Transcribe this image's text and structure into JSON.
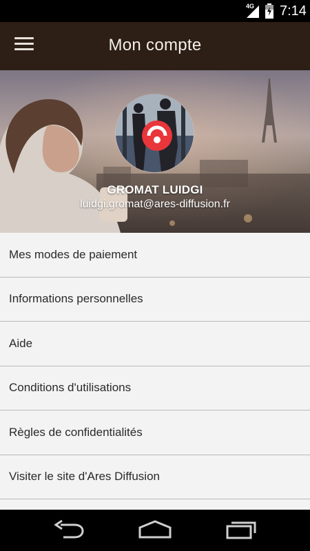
{
  "status_bar": {
    "network": "4G",
    "time": "7:14"
  },
  "app_bar": {
    "title": "Mon compte",
    "menu_icon": "hamburger-menu-icon"
  },
  "profile": {
    "name": "GROMAT LUIDGI",
    "email": "luidgi.gromat@ares-diffusion.fr"
  },
  "menu": {
    "items": [
      {
        "label": "Mes modes de paiement"
      },
      {
        "label": "Informations personnelles"
      },
      {
        "label": "Aide"
      },
      {
        "label": "Conditions d'utilisations"
      },
      {
        "label": "Règles de confidentialités"
      },
      {
        "label": "Visiter le site d'Ares Diffusion"
      }
    ]
  },
  "nav_bar": {
    "back_icon": "back-icon",
    "home_icon": "home-icon",
    "recents_icon": "recents-icon"
  },
  "colors": {
    "app_bar": "#2d1f16",
    "brand_red": "#e8363a",
    "list_background": "#f3f3f3"
  }
}
